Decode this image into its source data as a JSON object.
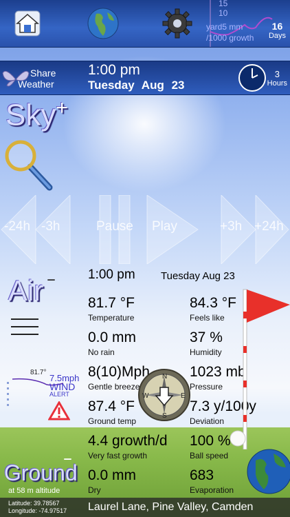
{
  "header": {
    "spark_label_1": "15",
    "spark_label_2": "10",
    "spark_label_3": "yard5 mm",
    "spark_label_4": "/1000 growth",
    "days_value": "16",
    "days_label": "Days"
  },
  "timebar": {
    "share_label_1": "Share",
    "share_label_2": "Weather",
    "time": "1:00 pm",
    "date": "Tuesday  Aug 23",
    "hours_value": "3",
    "hours_label": "Hours"
  },
  "sky": {
    "title": "Sky",
    "plus": "+"
  },
  "controls": {
    "back24": "-24h",
    "back3": "-3h",
    "pause": "Pause",
    "play": "Play",
    "fwd3": "+3h",
    "fwd24": "+24h"
  },
  "air": {
    "title": "Air",
    "minus": "–"
  },
  "conditions": {
    "time": "1:00 pm",
    "date": "Tuesday  Aug 23",
    "items": [
      {
        "value": "81.7 °F",
        "label": "Temperature"
      },
      {
        "value": "84.3 °F",
        "label": "Feels like"
      },
      {
        "value": "0.0 mm",
        "label": "No rain"
      },
      {
        "value": "37 %",
        "label": "Humidity"
      },
      {
        "value": "8(10)Mph",
        "label": "Gentle breeze"
      },
      {
        "value": "1023 mb",
        "label": "Pressure"
      },
      {
        "value": "87.4 °F",
        "label": "Ground temp"
      },
      {
        "value": "7.3 y/100y",
        "label": "Deviation"
      },
      {
        "value": "4.4 growth/d",
        "label": "Very fast growth"
      },
      {
        "value": "100 %",
        "label": "Ball speed"
      },
      {
        "value": "0.0 mm",
        "label": "Dry"
      },
      {
        "value": "683",
        "label": "Evaporation"
      }
    ]
  },
  "wind": {
    "temp_small": "81.7°",
    "speed": "7.5mph",
    "word": "WIND",
    "alert": "ALERT"
  },
  "compass": {
    "n": "N",
    "s": "S",
    "e": "E",
    "w": "W"
  },
  "ground": {
    "title": "Ground",
    "minus": "–",
    "altitude": "at 58 m altitude"
  },
  "footer": {
    "latitude": "Latitude: 39.78567",
    "longitude": "Longitude: -74.97517",
    "location": "Laurel Lane, Pine Valley, Camden"
  },
  "colors": {
    "accent": "#2f5dbd",
    "flag": "#e8302a",
    "wind": "#3a35c9"
  }
}
